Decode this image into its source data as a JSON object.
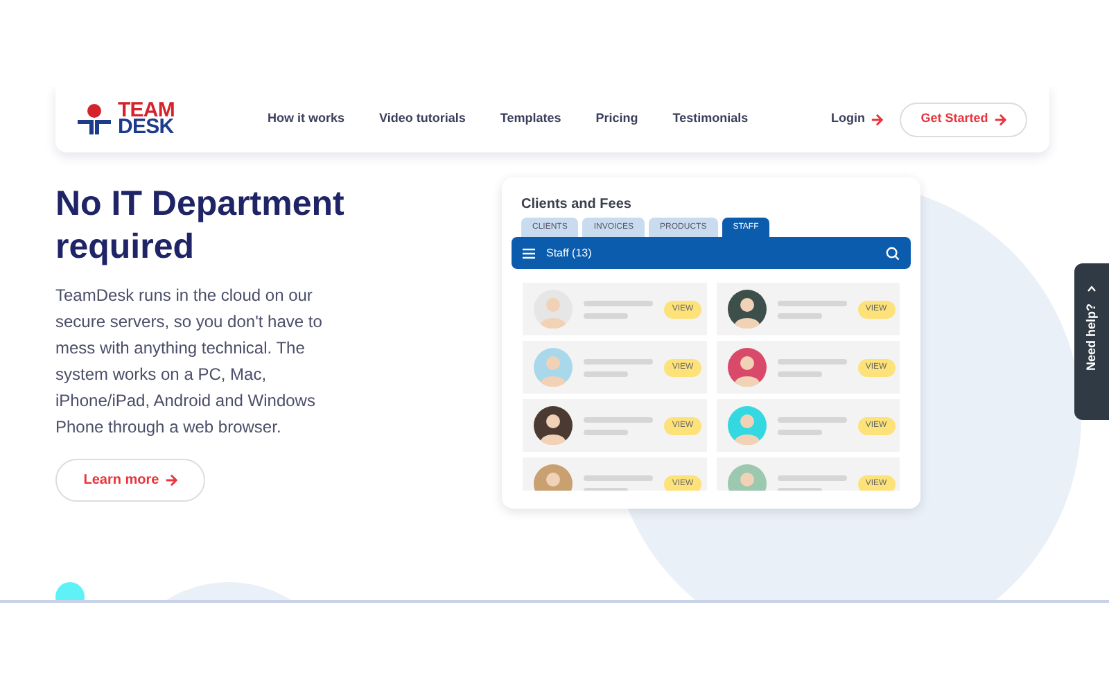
{
  "logo": {
    "line_1": "TEAM",
    "line_2": "DESK"
  },
  "nav": {
    "links": [
      "How it works",
      "Video tutorials",
      "Templates",
      "Pricing",
      "Testimonials"
    ],
    "login": "Login",
    "cta": "Get Started"
  },
  "hero": {
    "heading": "No IT Department required",
    "body": "TeamDesk runs in the cloud on our secure servers, so you don't have to mess with anything technical. The system works on a PC, Mac, iPhone/iPad, Android and Windows Phone through a web browser.",
    "button": "Learn more"
  },
  "app_preview": {
    "title": "Clients and Fees",
    "tabs": [
      {
        "label": "CLIENTS",
        "selected": false
      },
      {
        "label": "INVOICES",
        "selected": false
      },
      {
        "label": "PRODUCTS",
        "selected": false
      },
      {
        "label": "STAFF",
        "selected": true
      }
    ],
    "list_title": "Staff (13)",
    "staff_cards": [
      {
        "button": "VIEW",
        "color": "#e6e6e6"
      },
      {
        "button": "VIEW",
        "color": "#3d4f4a"
      },
      {
        "button": "VIEW",
        "color": "#a8d8ea"
      },
      {
        "button": "VIEW",
        "color": "#d94a6a"
      },
      {
        "button": "VIEW",
        "color": "#4a3a32"
      },
      {
        "button": "VIEW",
        "color": "#34d8e0"
      },
      {
        "button": "VIEW",
        "color": "#c9a070"
      },
      {
        "button": "VIEW",
        "color": "#9cc8b0"
      }
    ]
  },
  "help_tab": {
    "label": "Need help?"
  }
}
